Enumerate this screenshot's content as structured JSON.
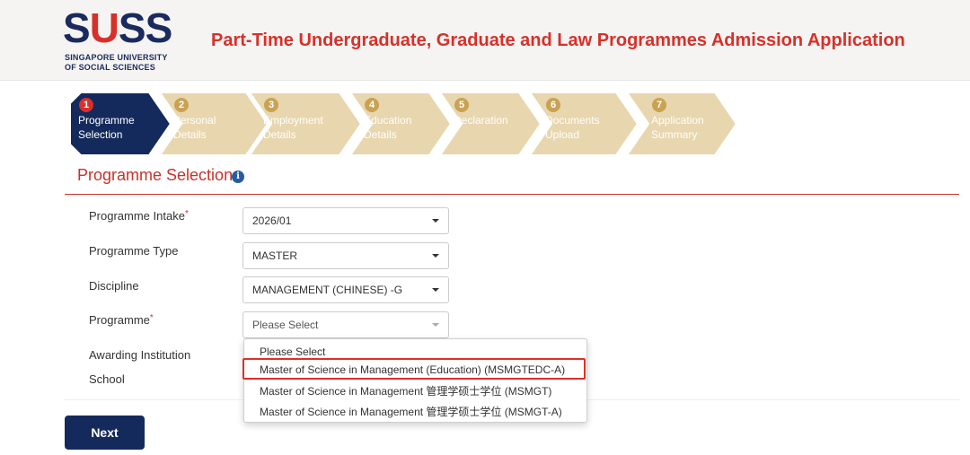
{
  "brand": {
    "logo_word_a": "S",
    "logo_word_b": "U",
    "logo_word_c": "SS",
    "logo_line1": "SINGAPORE UNIVERSITY",
    "logo_line2": "OF SOCIAL SCIENCES",
    "title": "Part-Time Undergraduate, Graduate and Law Programmes Admission Application"
  },
  "colors": {
    "accent_red": "#d8302a",
    "navy": "#142a5c",
    "step_inactive": "#e8d6ae",
    "step_active": "#142a5c"
  },
  "steps": [
    {
      "num": "1",
      "label": "Programme\nSelection",
      "active": true
    },
    {
      "num": "2",
      "label": "Personal\nDetails",
      "active": false
    },
    {
      "num": "3",
      "label": "Employment\nDetails",
      "active": false
    },
    {
      "num": "4",
      "label": "Education\nDetails",
      "active": false
    },
    {
      "num": "5",
      "label": "Declaration",
      "active": false
    },
    {
      "num": "6",
      "label": "Documents\nUpload",
      "active": false
    },
    {
      "num": "7",
      "label": "Application\nSummary",
      "active": false
    }
  ],
  "section": {
    "title": "Programme Selection",
    "info_icon": "info-icon"
  },
  "form": {
    "intake_label": "Programme Intake",
    "intake_value": "2026/01",
    "type_label": "Programme Type",
    "type_value": "MASTER",
    "discipline_label": "Discipline",
    "discipline_value": "MANAGEMENT (CHINESE) -G",
    "programme_label": "Programme",
    "programme_value": "Please Select",
    "awarding_label": "Awarding Institution",
    "school_label": "School",
    "required_mark": "*"
  },
  "dropdown": {
    "options": [
      "Please Select",
      "Master of Science in Management (Education) (MSMGTEDC-A)",
      "Master of Science in Management 管理学硕士学位 (MSMGT)",
      "Master of Science in Management 管理学硕士学位 (MSMGT-A)"
    ],
    "highlighted_index": 1
  },
  "actions": {
    "next_label": "Next"
  }
}
